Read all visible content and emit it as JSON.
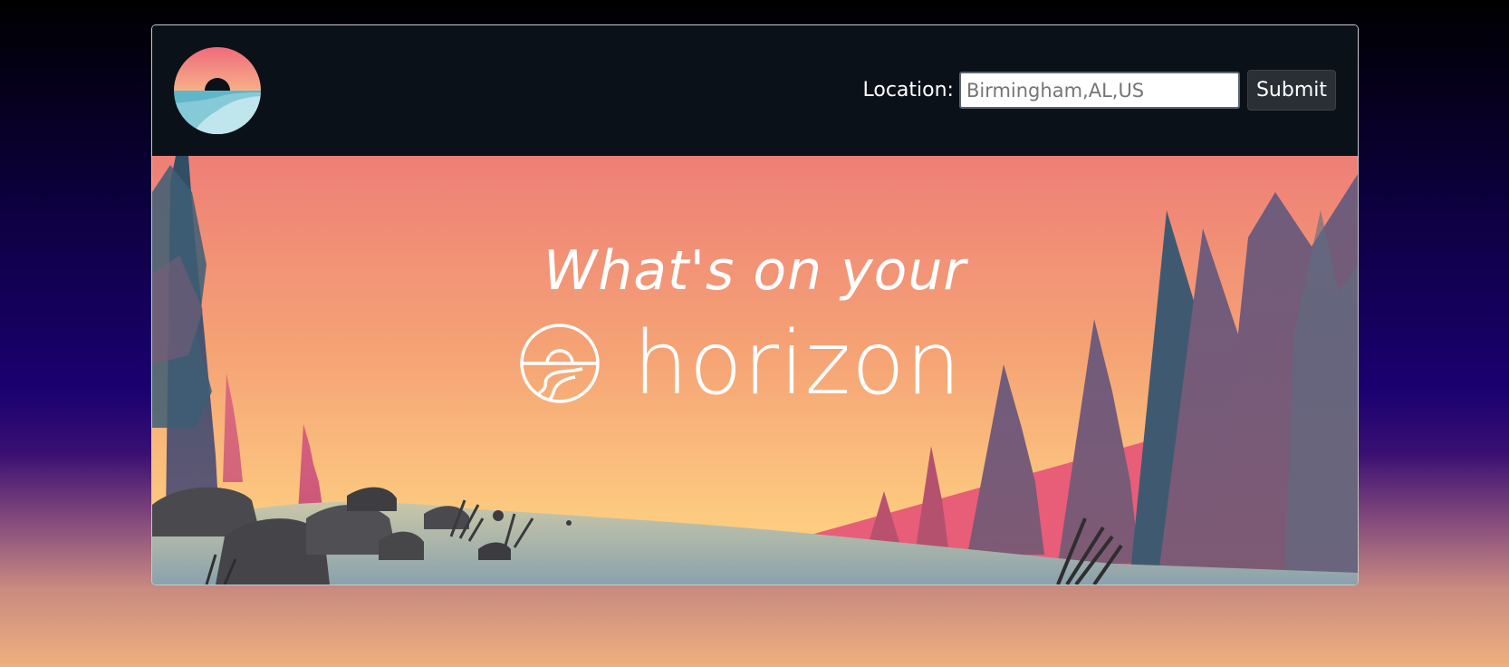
{
  "header": {
    "logo_icon": "sunset-horizon-logo-icon",
    "location_label": "Location:",
    "location_placeholder": "Birmingham,AL,US",
    "submit_label": "Submit"
  },
  "hero": {
    "tagline": "What's on your",
    "brand_icon": "horizon-line-icon",
    "brand_name": "horizon"
  },
  "colors": {
    "header_bg": "#0b1118",
    "sky_top": "#ee8078",
    "sky_bottom": "#fecf80",
    "mountain": "#e75d7a",
    "tree_dark": "#2f4f66",
    "tree_mauve": "#7a5a78"
  }
}
